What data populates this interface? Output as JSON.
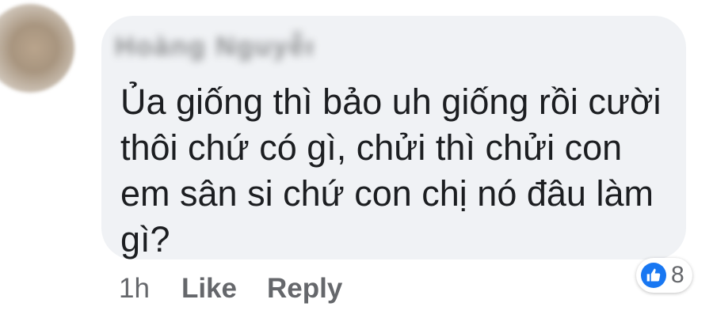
{
  "comment": {
    "author": "Hoàng Nguyễn",
    "text": "Ủa giống thì bảo uh giống rồi cười thôi chứ có gì, chửi thì chửi con em sân si chứ con chị nó đâu làm gì?"
  },
  "actions": {
    "time": "1h",
    "like_label": "Like",
    "reply_label": "Reply"
  },
  "reactions": {
    "icon": "like-icon",
    "count": "8",
    "color": "#1877f2"
  },
  "colors": {
    "bubble": "#f0f2f5",
    "text": "#1c1e21",
    "meta": "#65676b"
  }
}
